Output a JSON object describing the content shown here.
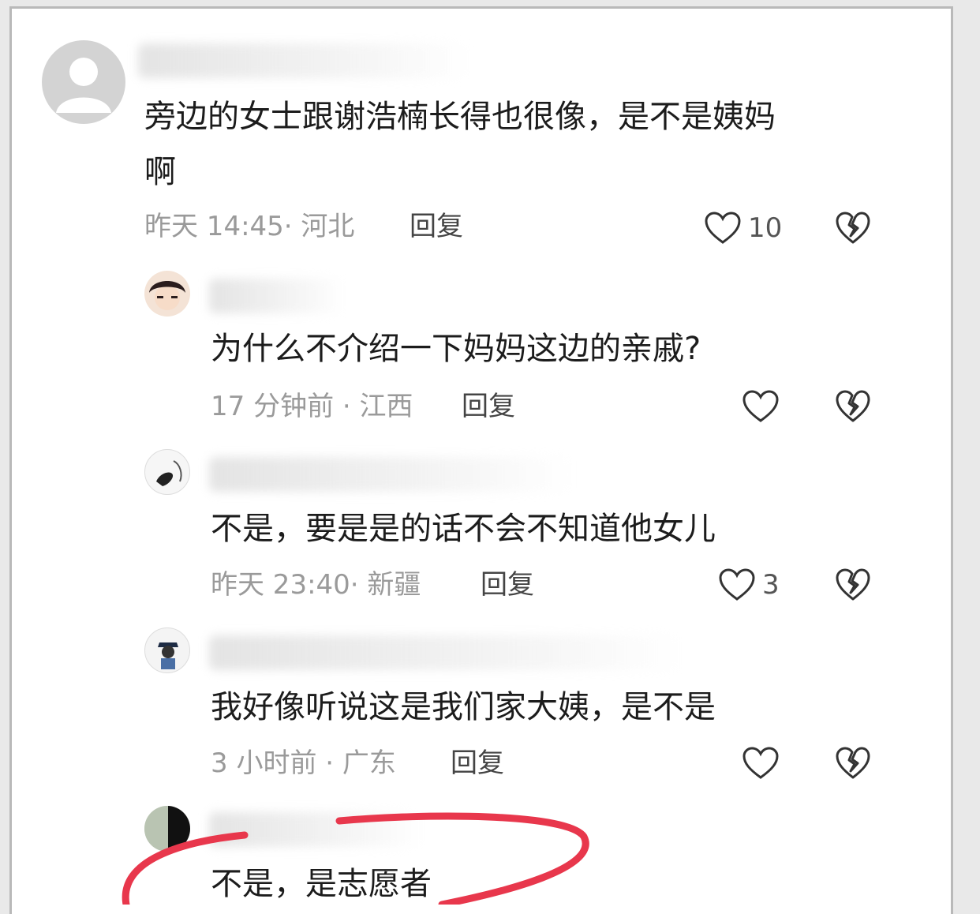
{
  "comments": [
    {
      "text_line1": "旁边的女士跟谢浩楠长得也很像，是不是姨妈",
      "text_line2": "啊",
      "meta": "昨天 14:45· 河北",
      "reply_label": "回复",
      "likes": "10"
    },
    {
      "text": "为什么不介绍一下妈妈这边的亲戚?",
      "meta": "17 分钟前 · 江西",
      "reply_label": "回复",
      "likes": ""
    },
    {
      "text": "不是，要是是的话不会不知道他女儿",
      "meta": "昨天 23:40· 新疆",
      "reply_label": "回复",
      "likes": "3"
    },
    {
      "text": "我好像听说这是我们家大姨，是不是",
      "meta": "3 小时前 · 广东",
      "reply_label": "回复",
      "likes": ""
    },
    {
      "text": "不是，是志愿者"
    }
  ],
  "colors": {
    "annotation": "#e8374c",
    "icon_stroke": "#333333",
    "meta_text": "#9a9a9a"
  },
  "icons": {
    "like": "heart-outline-icon",
    "dislike": "broken-heart-icon",
    "avatar_default": "default-user-avatar"
  }
}
